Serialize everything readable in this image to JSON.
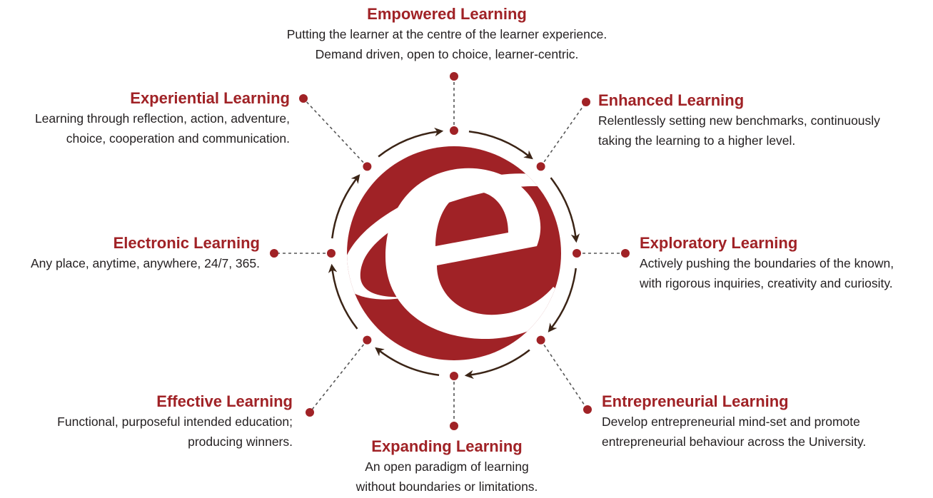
{
  "colors": {
    "accent": "#a02226",
    "arrow": "#3b2416",
    "text": "#231f20",
    "logo_swoosh": "#ffffff"
  },
  "logo": {
    "icon": "e-orbit-logo"
  },
  "nodes": {
    "empowered": {
      "title": "Empowered Learning",
      "lines": [
        "Putting the learner at the centre of the learner experience.",
        "Demand driven, open to choice, learner-centric."
      ]
    },
    "enhanced": {
      "title": "Enhanced Learning",
      "lines": [
        "Relentlessly setting new benchmarks, continuously",
        "taking the learning to a higher level."
      ]
    },
    "exploratory": {
      "title": "Exploratory Learning",
      "lines": [
        "Actively pushing the boundaries of the known,",
        "with rigorous inquiries, creativity and curiosity."
      ]
    },
    "entrepreneurial": {
      "title": "Entrepreneurial Learning",
      "lines": [
        "Develop entrepreneurial mind-set and promote",
        "entrepreneurial behaviour across the University."
      ]
    },
    "expanding": {
      "title": "Expanding Learning",
      "lines": [
        "An open paradigm of learning",
        "without boundaries or limitations."
      ]
    },
    "effective": {
      "title": "Effective Learning",
      "lines": [
        "Functional, purposeful intended education;",
        "producing winners."
      ]
    },
    "electronic": {
      "title": "Electronic Learning",
      "lines": [
        "Any place, anytime, anywhere, 24/7, 365."
      ]
    },
    "experiential": {
      "title": "Experiential Learning",
      "lines": [
        "Learning through reflection, action, adventure,",
        "choice, cooperation and communication."
      ]
    }
  }
}
